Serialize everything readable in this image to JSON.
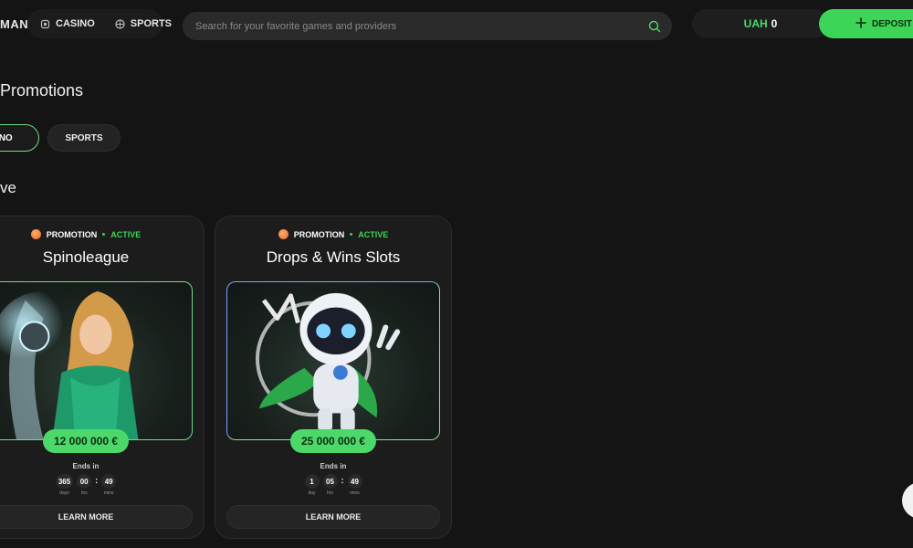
{
  "header": {
    "logo_text": "MAN",
    "nav": [
      {
        "label": "CASINO",
        "icon": "slot-icon"
      },
      {
        "label": "SPORTS",
        "icon": "ball-icon"
      }
    ],
    "search_placeholder": "Search for your favorite games and providers",
    "balance_currency": "UAH",
    "balance_amount": "0",
    "deposit_label": "DEPOSIT"
  },
  "page": {
    "title": "Promotions",
    "tabs": [
      "SINO",
      "SPORTS"
    ],
    "section_title": "ve"
  },
  "cards": [
    {
      "type": "PROMOTION",
      "status": "ACTIVE",
      "title": "Spinoleague",
      "prize": "12 000 000 €",
      "ends_label": "Ends in",
      "timer": [
        {
          "value": "365",
          "unit": "days"
        },
        {
          "value": "00",
          "unit": "hrs"
        },
        {
          "value": "49",
          "unit": "mins"
        }
      ],
      "button": "LEARN MORE"
    },
    {
      "type": "PROMOTION",
      "status": "ACTIVE",
      "title": "Drops & Wins Slots",
      "prize": "25 000 000 €",
      "ends_label": "Ends in",
      "timer": [
        {
          "value": "1",
          "unit": "day"
        },
        {
          "value": "05",
          "unit": "hrs"
        },
        {
          "value": "49",
          "unit": "mins"
        }
      ],
      "button": "LEARN MORE"
    }
  ],
  "colors": {
    "accent": "#3dd557",
    "background": "#141414",
    "card": "#1c1c1c"
  }
}
